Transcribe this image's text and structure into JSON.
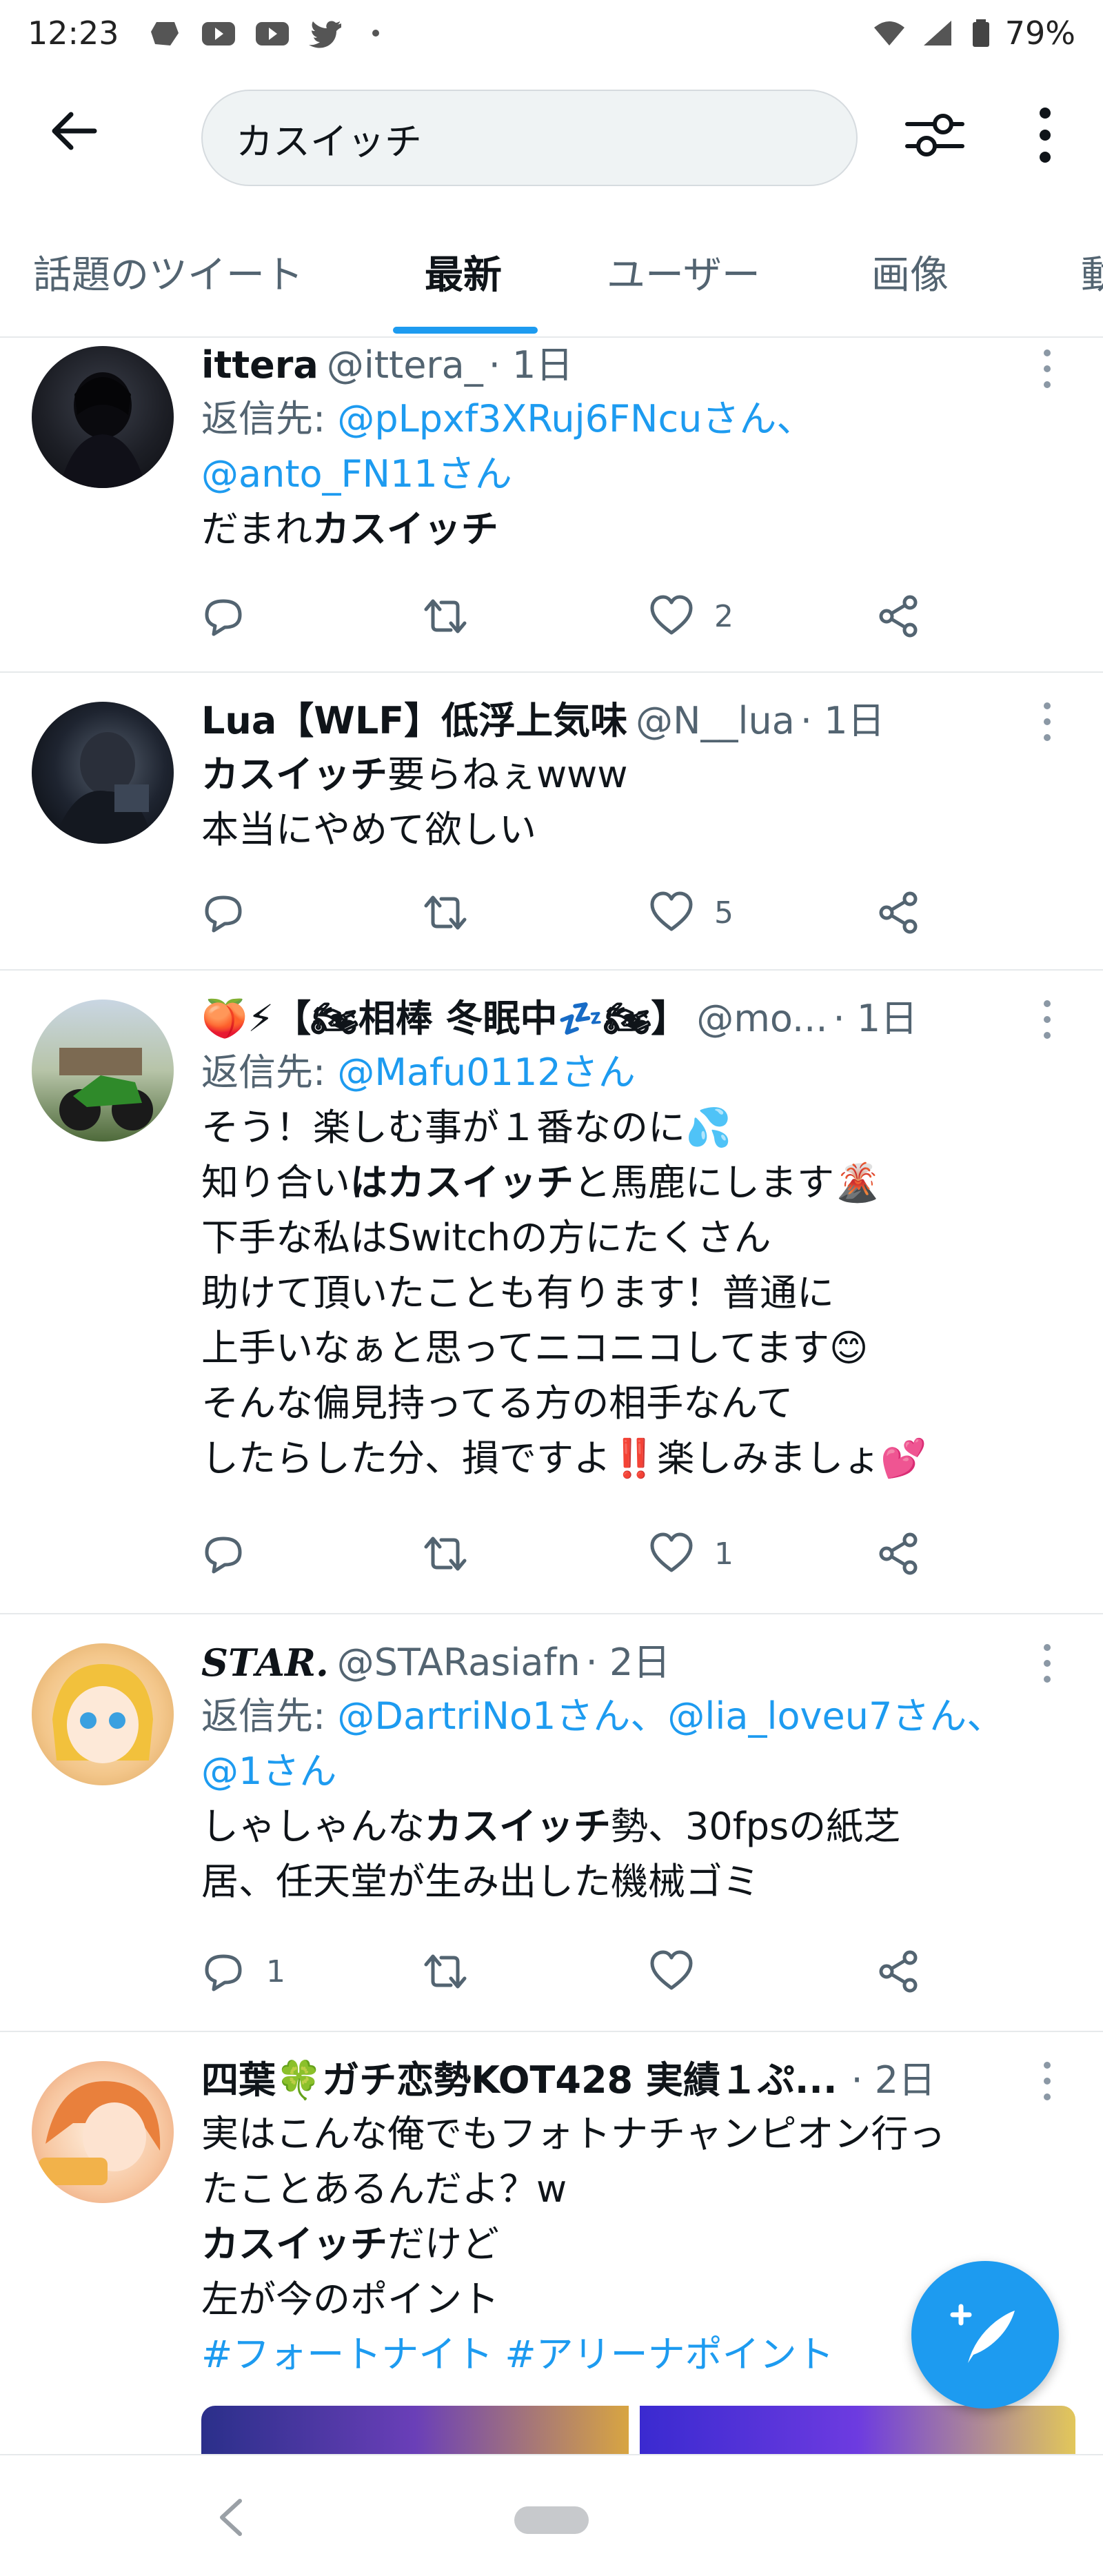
{
  "status_bar": {
    "time": "12:23",
    "battery": "79%"
  },
  "search": {
    "query": "カスイッチ"
  },
  "tabs": [
    {
      "label": "話題のツイート"
    },
    {
      "label": "最新"
    },
    {
      "label": "ユーザー"
    },
    {
      "label": "画像"
    },
    {
      "label": "動"
    }
  ],
  "tweets": [
    {
      "name": "ittera",
      "handle": "@ittera_",
      "time": "· 1日",
      "reply_prefix": "返信先: ",
      "reply_mentions_line1": "@pLpxf3XRuj6FNcuさん、",
      "reply_mentions_line2": "@anto_FN11さん",
      "text_pre": "だまれ",
      "text_bold": "カスイッチ",
      "text_post": "",
      "replies": "",
      "retweets": "",
      "likes": "2"
    },
    {
      "name": "Lua【WLF】低浮上気味",
      "handle": "@N__lua",
      "time": "· 1日",
      "text_bold": "カスイッチ",
      "text_post": "要らねぇwww\n本当にやめて欲しい",
      "replies": "",
      "retweets": "",
      "likes": "5"
    },
    {
      "name": "🍑⚡【🏍相棒 冬眠中💤🏍】",
      "handle": "@mo...",
      "time": "· 1日",
      "reply_prefix": "返信先: ",
      "reply_mentions_line1": "@Mafu0112さん",
      "text_line1": "そう！楽しむ事が１番なのに💦",
      "text_line2_pre": "知り合い",
      "text_line2_bold": "はカスイッチ",
      "text_line2_post": "と馬鹿にします🌋",
      "text_rest": "下手な私はSwitchの方にたくさん\n助けて頂いたことも有ります！普通に\n上手いなぁと思ってニコニコしてます😊\nそんな偏見持ってる方の相手なんて\nしたらした分、損ですよ‼️楽しみましょ💕",
      "replies": "",
      "retweets": "",
      "likes": "1"
    },
    {
      "name": "𝑺𝑻𝑨𝑹.",
      "handle": "@STARasiafn",
      "time": "· 2日",
      "reply_prefix": "返信先: ",
      "reply_mentions_line1": "@DartriNo1さん、@lia_loveu7さん、",
      "reply_mentions_line2": "@1さん",
      "text_pre": "しゃしゃんな",
      "text_bold": "カスイッチ",
      "text_post": "勢、30fpsの紙芝\n居、任天堂が生み出した機械ゴミ",
      "replies": "1",
      "retweets": "",
      "likes": ""
    },
    {
      "name": "四葉🍀ガチ恋勢KOT428 実績１ぷ...",
      "handle": "",
      "time": "· 2日",
      "text_line1": "実はこんな俺でもフォトナチャンピオン行っ\nたことあるんだよ？w",
      "text_bold": "カスイッチ",
      "text_post": "だけど\n左が今のポイント",
      "hashtags": "#フォートナイト #アリーナポイント"
    }
  ],
  "colors": {
    "accent": "#1d9bf0",
    "text": "#0f1419",
    "secondary": "#536471"
  }
}
